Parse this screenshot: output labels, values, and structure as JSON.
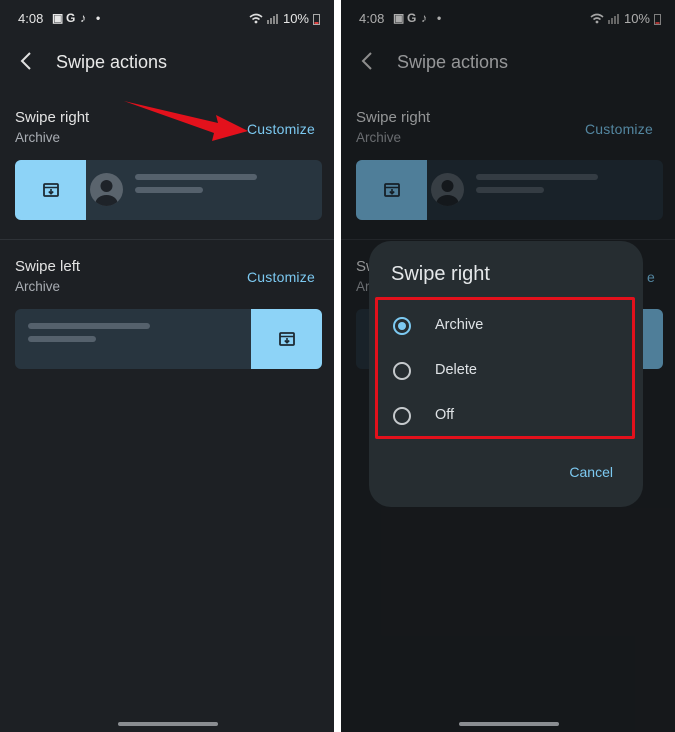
{
  "status_bar": {
    "time": "4:08",
    "icons": [
      "photo-icon",
      "g-icon",
      "music-icon",
      "dot-icon"
    ],
    "battery": "10%"
  },
  "left_panel": {
    "header": {
      "title": "Swipe actions"
    },
    "swipe_right": {
      "title": "Swipe right",
      "value": "Archive",
      "customize": "Customize"
    },
    "swipe_left": {
      "title": "Swipe left",
      "value": "Archive",
      "customize": "Customize"
    }
  },
  "right_panel": {
    "header": {
      "title": "Swipe actions"
    },
    "swipe_right": {
      "title": "Swipe right",
      "value": "Archive",
      "customize": "Customize"
    },
    "swipe_left_partial": {
      "title": "Sw",
      "value": "Arc",
      "customize": "e"
    },
    "dialog": {
      "title": "Swipe right",
      "options": [
        {
          "label": "Archive",
          "selected": true
        },
        {
          "label": "Delete",
          "selected": false
        },
        {
          "label": "Off",
          "selected": false
        }
      ],
      "cancel": "Cancel"
    }
  },
  "colors": {
    "accent": "#7cc9f1",
    "action_bg": "#8dd3f7",
    "highlight": "#e3111c",
    "background": "#1d2024"
  }
}
